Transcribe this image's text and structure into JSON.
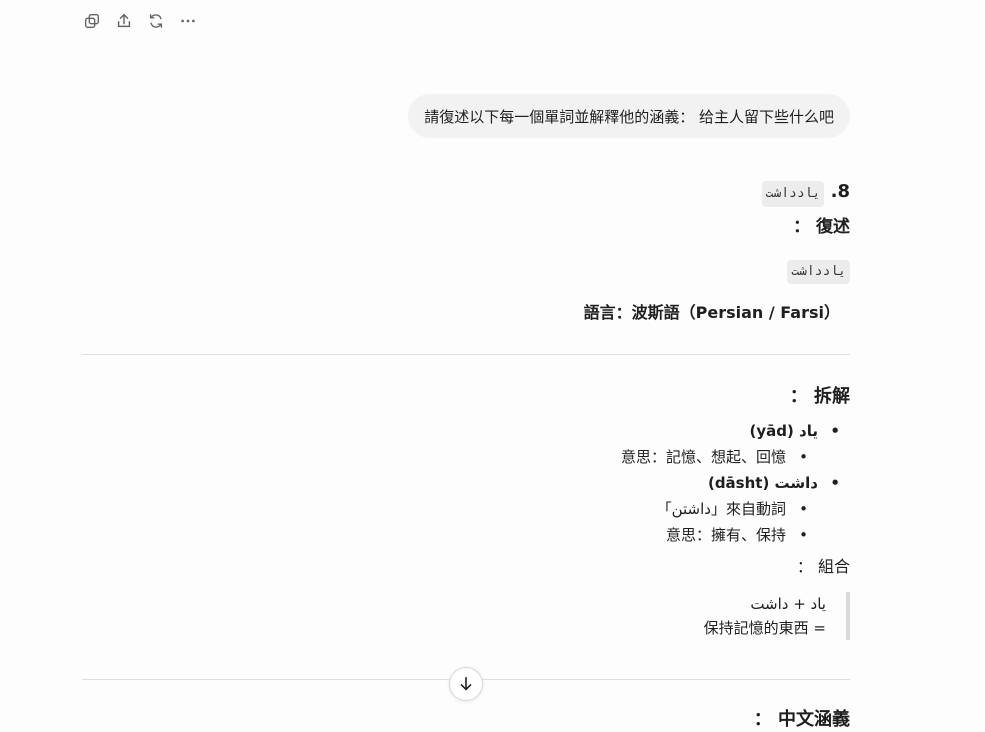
{
  "toolbar": {
    "icons": [
      "copy-icon",
      "share-icon",
      "regenerate-icon",
      "more-icon"
    ]
  },
  "user_message": "請復述以下每一個單詞並解釋他的涵義： 给主人留下些什么吧",
  "section8": {
    "number": "8.",
    "word": "یادداشت",
    "restate_label": "復述 ：",
    "restate_code": "یادداشت",
    "language_line": "語言：波斯語（Persian / Farsi）"
  },
  "breakdown": {
    "heading": "拆解 ：",
    "items": [
      {
        "text": "یاد (yād)",
        "level": 1,
        "bold": true
      },
      {
        "text": "意思：記憶、想起、回憶",
        "level": 2,
        "bold": false
      },
      {
        "text": "داشت (dāsht)",
        "level": 1,
        "bold": true
      },
      {
        "text": "來自動詞「داشتن」",
        "level": 2,
        "bold": false
      },
      {
        "text": "意思：擁有、保持",
        "level": 2,
        "bold": false
      }
    ]
  },
  "combination": {
    "label": "組合 ：",
    "line1": "یاد + داشت",
    "line2": "= 保持記憶的東西"
  },
  "next_heading": "中文涵義 ："
}
